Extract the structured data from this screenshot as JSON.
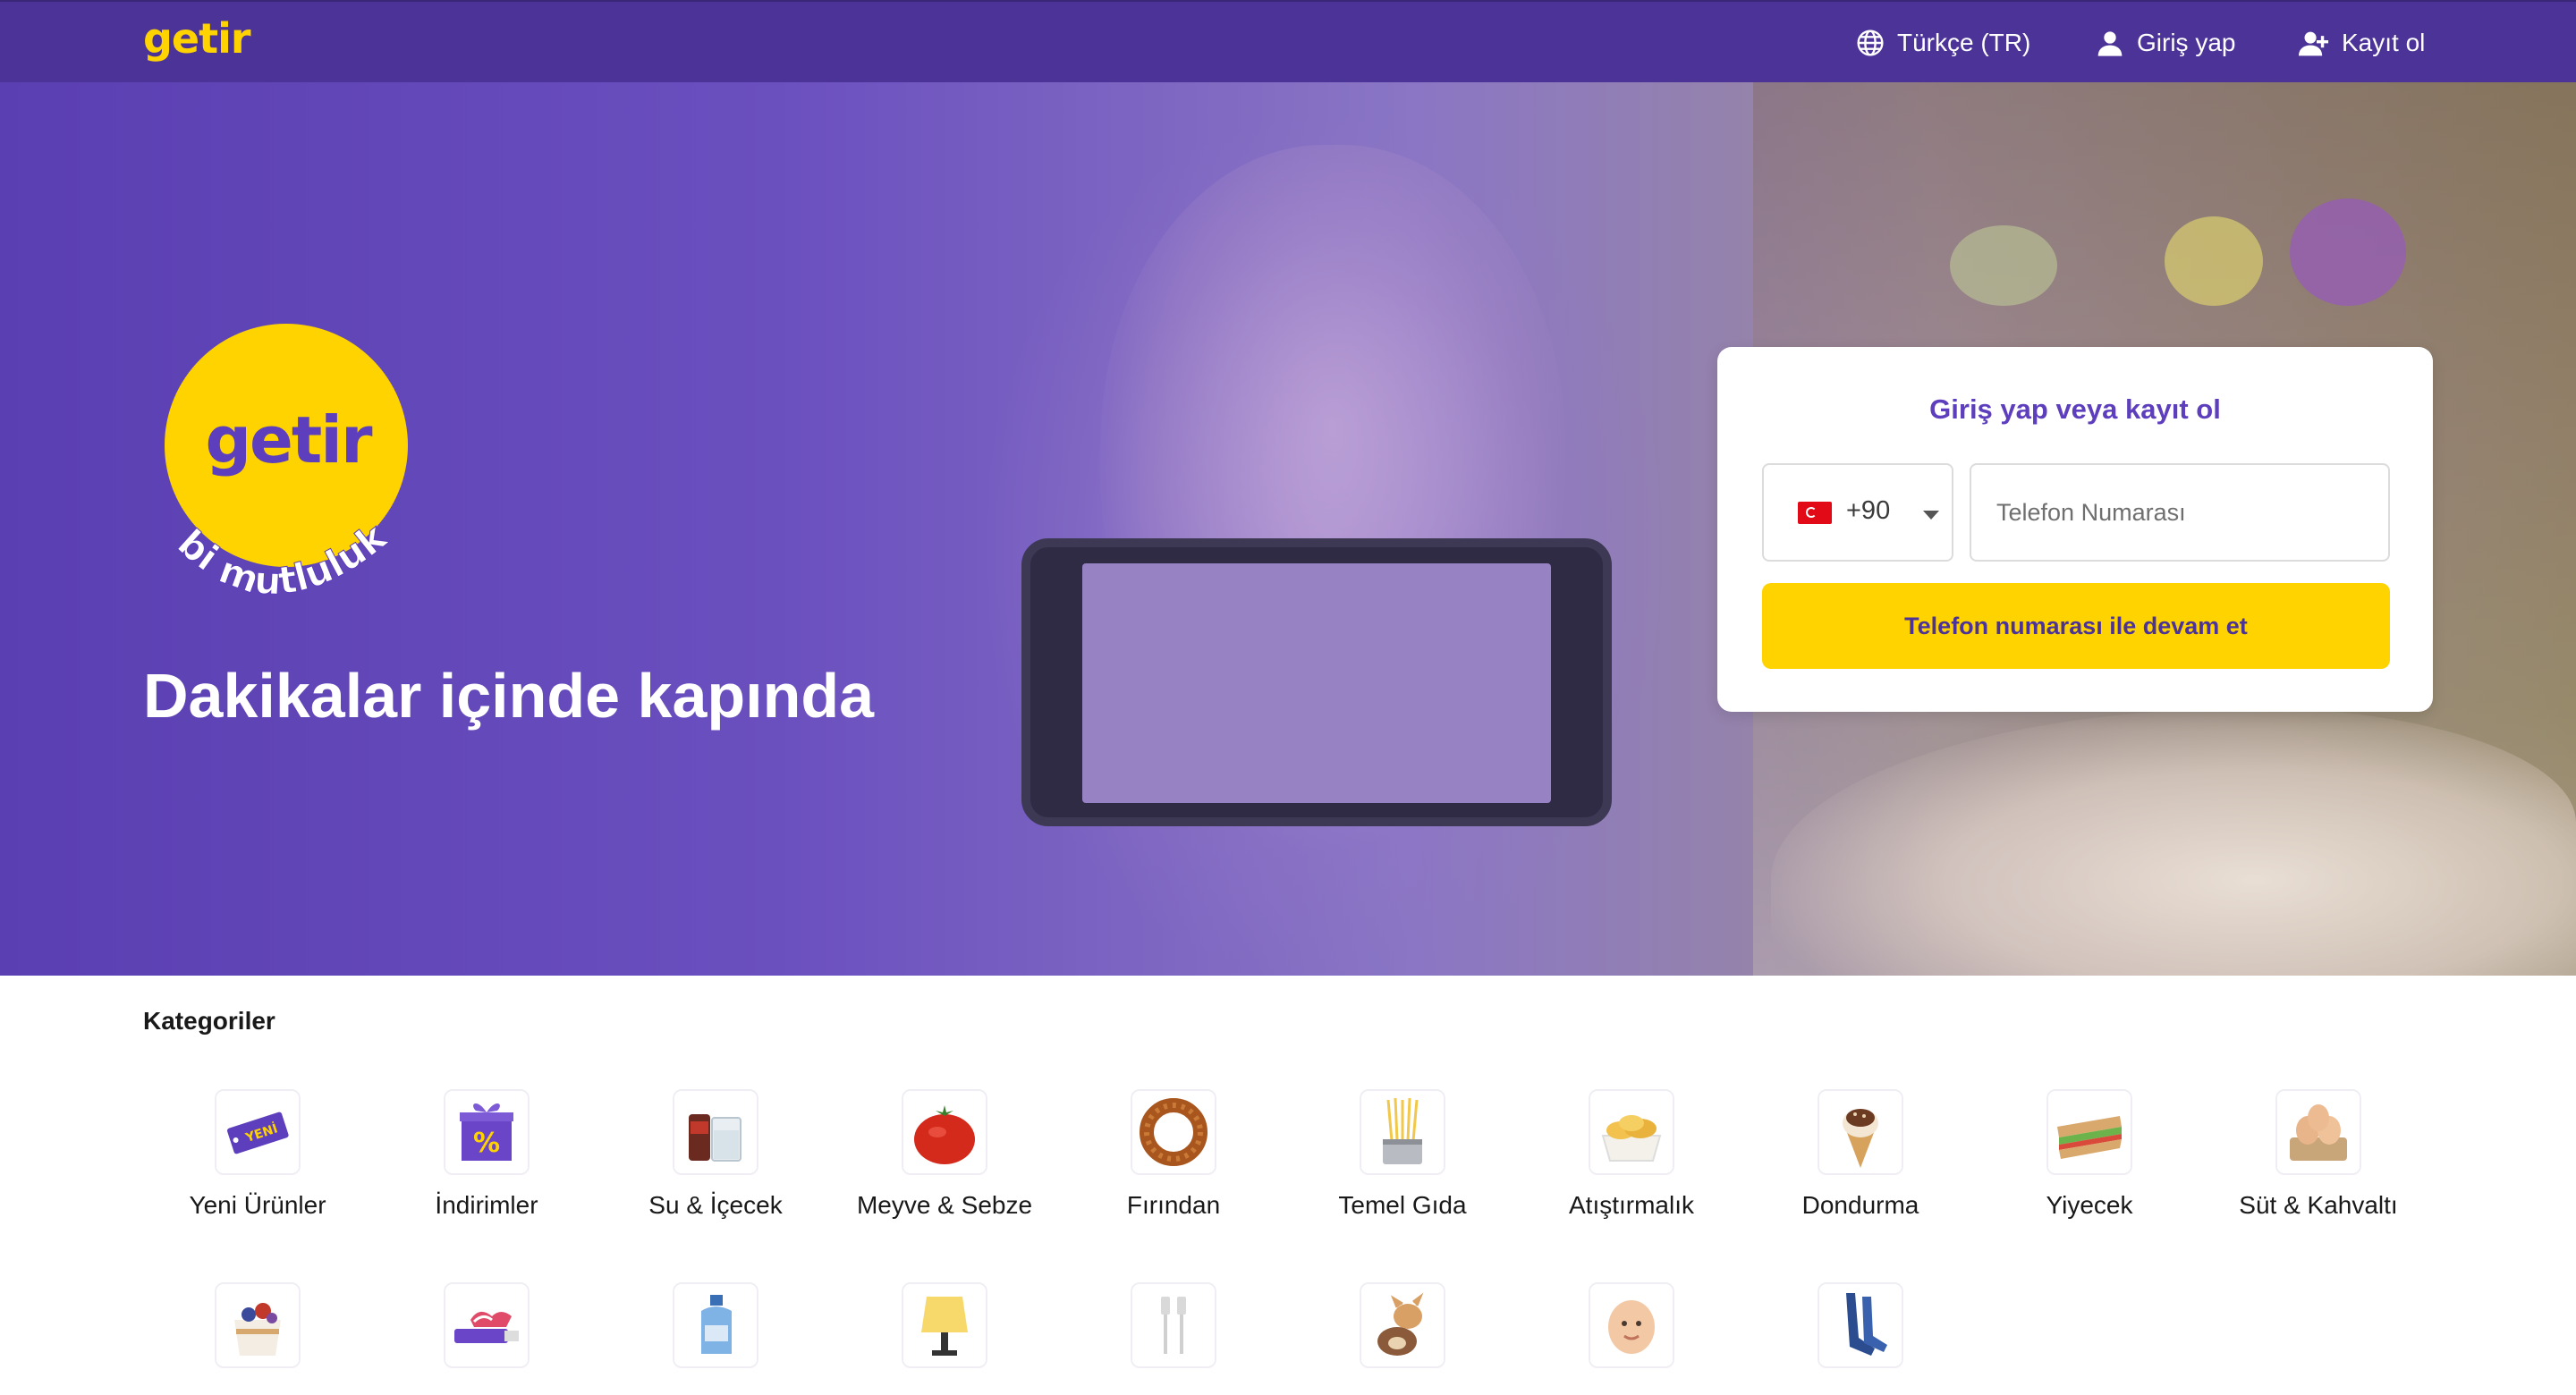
{
  "header": {
    "logo": "getir",
    "language": "Türkçe (TR)",
    "login": "Giriş yap",
    "register": "Kayıt ol"
  },
  "hero": {
    "badge_logo": "getir",
    "badge_slogan": "bi mutluluk",
    "title": "Dakikalar içinde kapında"
  },
  "login_card": {
    "title": "Giriş yap veya kayıt ol",
    "country_code": "+90",
    "phone_placeholder": "Telefon Numarası",
    "continue_button": "Telefon numarası ile devam et"
  },
  "categories": {
    "title": "Kategoriler",
    "row1": [
      {
        "label": "Yeni Ürünler",
        "icon": "new-tag-icon"
      },
      {
        "label": "İndirimler",
        "icon": "gift-discount-icon"
      },
      {
        "label": "Su & İçecek",
        "icon": "drinks-icon"
      },
      {
        "label": "Meyve & Sebze",
        "icon": "tomato-icon"
      },
      {
        "label": "Fırından",
        "icon": "simit-icon"
      },
      {
        "label": "Temel Gıda",
        "icon": "pasta-icon"
      },
      {
        "label": "Atıştırmalık",
        "icon": "chips-icon"
      },
      {
        "label": "Dondurma",
        "icon": "ice-cream-icon"
      },
      {
        "label": "Yiyecek",
        "icon": "sandwich-icon"
      },
      {
        "label": "Süt & Kahvaltı",
        "icon": "eggs-icon"
      }
    ],
    "row2_icons": [
      "yogurt-icon",
      "toothpaste-icon",
      "detergent-icon",
      "lamp-icon",
      "cable-icon",
      "pets-icon",
      "baby-icon",
      "stockings-icon"
    ]
  },
  "colors": {
    "brand_purple": "#5d3ebc",
    "header_purple": "#4c3398",
    "brand_yellow": "#ffd300"
  }
}
